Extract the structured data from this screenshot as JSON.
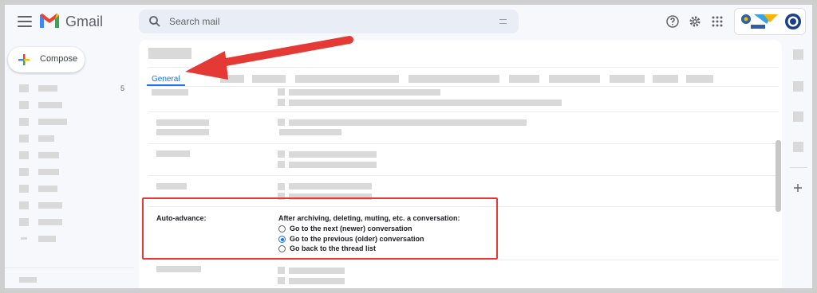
{
  "app": {
    "brand": "Gmail"
  },
  "search": {
    "placeholder": "Search mail"
  },
  "compose": {
    "label": "Compose"
  },
  "sidebar": {
    "count": "5"
  },
  "settings": {
    "tab_label": "General",
    "auto_advance": {
      "label": "Auto-advance:",
      "description": "After archiving, deleting, muting, etc. a conversation:",
      "options": [
        {
          "label": "Go to the next (newer) conversation",
          "selected": false
        },
        {
          "label": "Go to the previous (older) conversation",
          "selected": true
        },
        {
          "label": "Go back to the thread list",
          "selected": false
        }
      ]
    }
  },
  "colors": {
    "accent": "#1a73e8",
    "highlight": "#e53935",
    "brand_red": "#ea4335"
  },
  "icons": [
    "menu-icon",
    "gmail-logo",
    "search-icon",
    "filter-icon",
    "help-icon",
    "gear-icon",
    "apps-icon",
    "plus-icon",
    "arrow-annotation"
  ]
}
